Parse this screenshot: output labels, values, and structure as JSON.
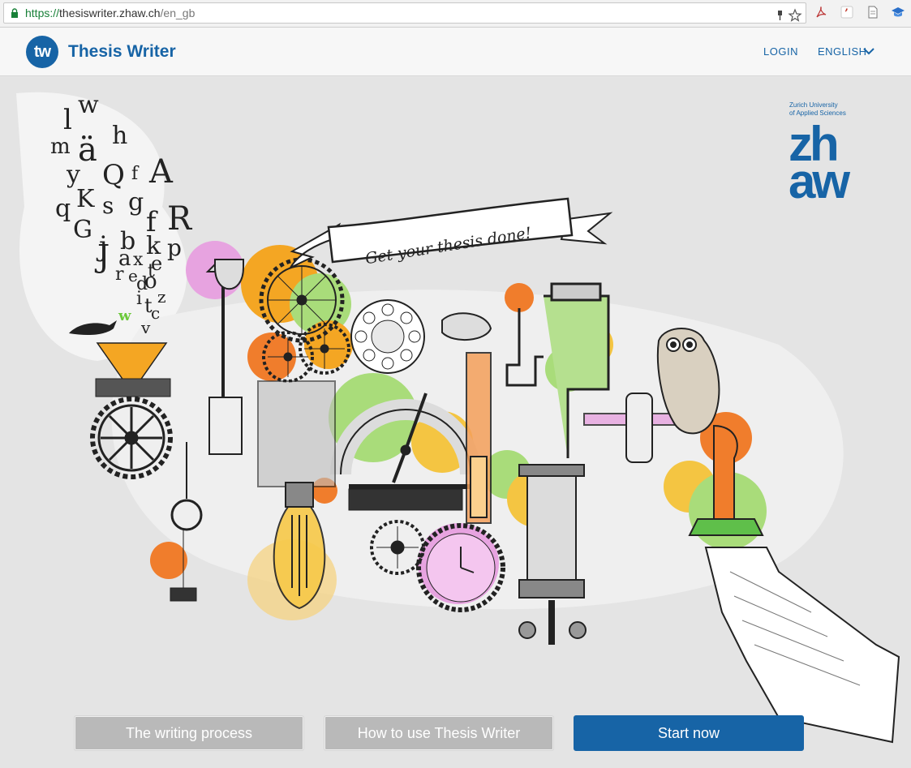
{
  "browser": {
    "url_scheme": "https://",
    "url_host": "thesiswriter.zhaw.ch",
    "url_path": "/en_gb",
    "icons": [
      "lock-icon",
      "key-icon",
      "star-icon",
      "pdf-icon",
      "quote-icon",
      "page-icon",
      "graduation-cap-icon"
    ]
  },
  "header": {
    "logo_text": "tw",
    "brand": "Thesis Writer",
    "login": "LOGIN",
    "language": "ENGLISH"
  },
  "hero": {
    "banner": "Get your thesis done!",
    "partner_caption_1": "Zurich University",
    "partner_caption_2": "of Applied Sciences",
    "partner_mark_1": "zh",
    "partner_mark_2": "aw",
    "letters": [
      "l",
      "w",
      "m",
      "ä",
      "h",
      "y",
      "Q",
      "f",
      "A",
      "q",
      "K",
      "s",
      "g",
      "f",
      "R",
      "G",
      "j",
      "b",
      "k",
      "p",
      "J",
      "a",
      "x",
      "t",
      "e",
      "r",
      "e",
      "d",
      "o",
      "i",
      "t",
      "z",
      "c",
      "v",
      "w"
    ]
  },
  "actions": {
    "writing_process": "The writing process",
    "how_to_use": "How to use Thesis Writer",
    "start_now": "Start now"
  },
  "colors": {
    "brand_blue": "#1764a6",
    "button_grey": "#b9b9b9",
    "accent_orange": "#f4a623",
    "accent_green": "#a9dc7a",
    "accent_pink": "#e7a3e0"
  }
}
